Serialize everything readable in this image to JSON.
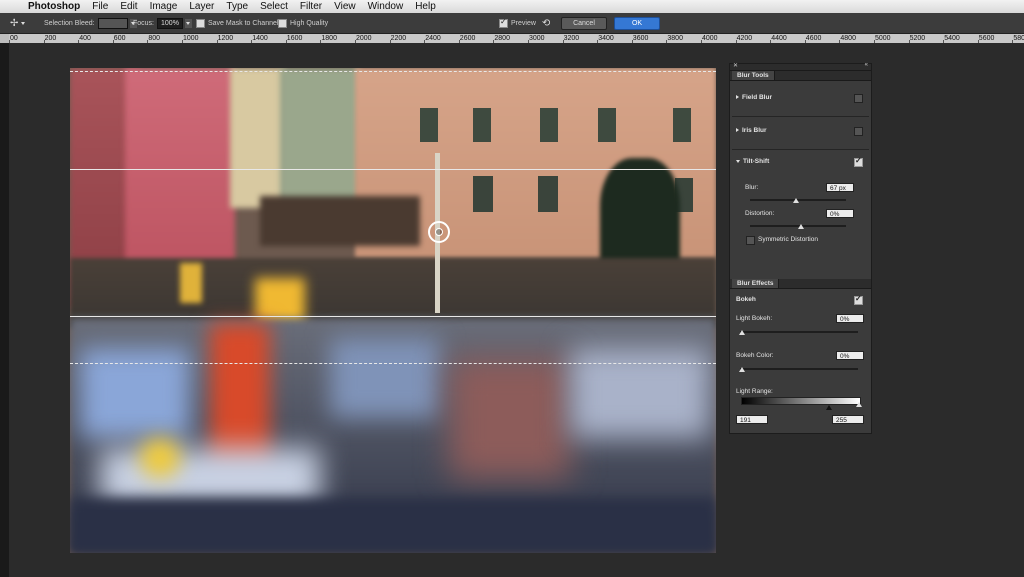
{
  "menubar": {
    "app_name": "Photoshop",
    "items": [
      "File",
      "Edit",
      "Image",
      "Layer",
      "Type",
      "Select",
      "Filter",
      "View",
      "Window",
      "Help"
    ]
  },
  "options_bar": {
    "selection_bleed_label": "Selection Bleed:",
    "focus_label": "Focus:",
    "focus_value": "100%",
    "save_mask_label": "Save Mask to Channels",
    "high_quality_label": "High Quality",
    "preview_label": "Preview",
    "preview_checked": true,
    "cancel_label": "Cancel",
    "ok_label": "OK"
  },
  "ruler": {
    "labels": [
      "00",
      "200",
      "400",
      "600",
      "800",
      "1000",
      "1200",
      "1400",
      "1600",
      "1800",
      "2000",
      "2200",
      "2400",
      "2600",
      "2800",
      "3000",
      "3200",
      "3400",
      "3600",
      "3800",
      "4000",
      "4200",
      "4400",
      "4600",
      "4800",
      "5000",
      "5200",
      "5400",
      "5600",
      "5800"
    ]
  },
  "blur_tools": {
    "tab_label": "Blur Tools",
    "field_blur": {
      "label": "Field Blur",
      "checked": false
    },
    "iris_blur": {
      "label": "Iris Blur",
      "checked": false
    },
    "tilt_shift": {
      "label": "Tilt-Shift",
      "checked": true,
      "blur_label": "Blur:",
      "blur_value": "67 px",
      "distortion_label": "Distortion:",
      "distortion_value": "0%",
      "symmetric_label": "Symmetric Distortion",
      "symmetric_checked": false
    }
  },
  "blur_effects": {
    "tab_label": "Blur Effects",
    "bokeh_label": "Bokeh",
    "bokeh_checked": true,
    "light_bokeh_label": "Light Bokeh:",
    "light_bokeh_value": "0%",
    "bokeh_color_label": "Bokeh Color:",
    "bokeh_color_value": "0%",
    "light_range_label": "Light Range:",
    "light_range_min": "191",
    "light_range_max": "255"
  },
  "colors": {
    "ok_button": "#3578d4",
    "panel_bg": "#3b3b3b",
    "app_bg": "#2b2b2b"
  }
}
